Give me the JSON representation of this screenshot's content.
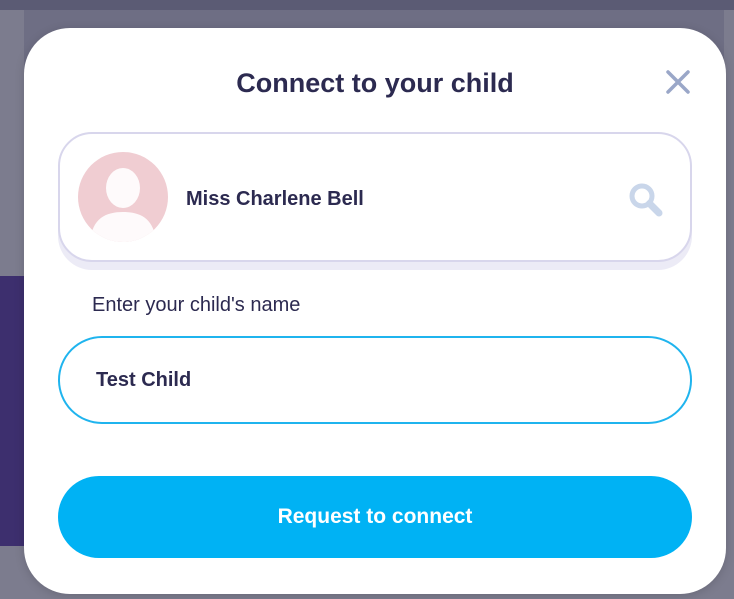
{
  "modal": {
    "title": "Connect to your child"
  },
  "teacher": {
    "name": "Miss Charlene Bell"
  },
  "child_field": {
    "label": "Enter your child's name",
    "value": "Test Child"
  },
  "actions": {
    "request_label": "Request to connect"
  },
  "icons": {
    "close": "close-icon",
    "search": "search-icon",
    "avatar": "person-silhouette-icon"
  },
  "colors": {
    "title_text": "#2c2a50",
    "close_icon": "#9aa7c8",
    "search_icon": "#c9d6ea",
    "input_border": "#1fb4ee",
    "primary_button": "#00b2f4",
    "avatar_bg": "#f0cdd2",
    "card_border": "#d8d6ec"
  }
}
